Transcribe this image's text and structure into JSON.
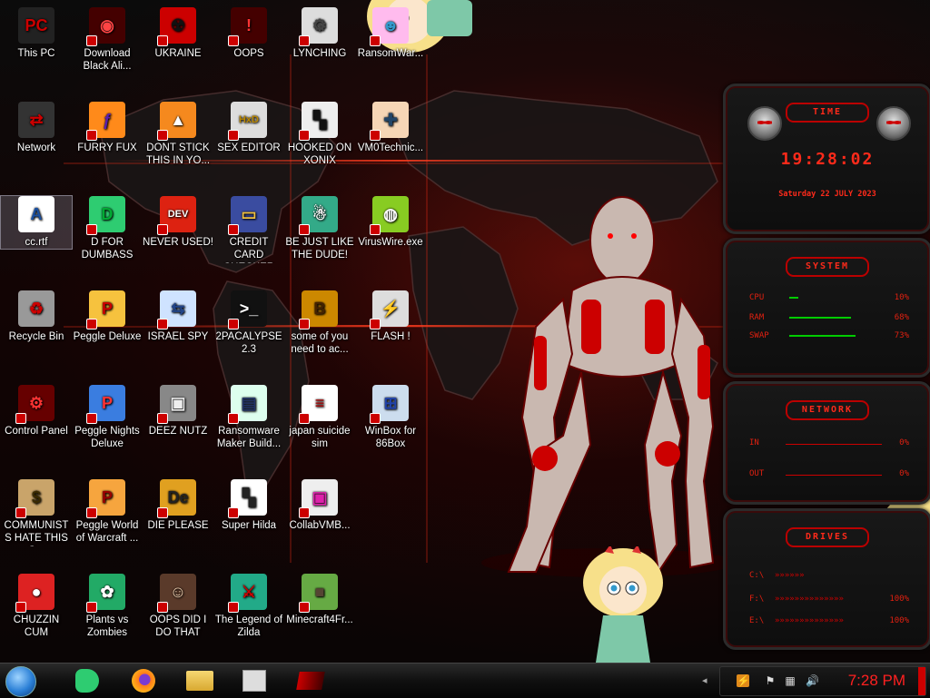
{
  "desktop": {
    "icons": [
      {
        "label": "This PC",
        "icon": "this-pc-icon"
      },
      {
        "label": "Network",
        "icon": "network-icon"
      },
      {
        "label": "cc.rtf",
        "icon": "rtf-document-icon"
      },
      {
        "label": "Recycle Bin",
        "icon": "recycle-bin-icon"
      },
      {
        "label": "Control Panel",
        "icon": "control-panel-icon"
      },
      {
        "label": "COMMUNISTS HATE THIS G...",
        "icon": "money-bag-icon"
      },
      {
        "label": "CHUZZIN CUM",
        "icon": "chuzzle-icon"
      },
      {
        "label": "Download Black Ali...",
        "icon": "alien-download-icon"
      },
      {
        "label": "FURRY FUX",
        "icon": "firefox-icon"
      },
      {
        "label": "D FOR DUMBASS",
        "icon": "d-app-icon"
      },
      {
        "label": "Peggle Deluxe",
        "icon": "peggle-icon"
      },
      {
        "label": "Peggle Nights Deluxe",
        "icon": "peggle-nights-icon"
      },
      {
        "label": "Peggle World of Warcraft ...",
        "icon": "peggle-wow-icon"
      },
      {
        "label": "Plants vs Zombies",
        "icon": "plants-vs-zombies-icon"
      },
      {
        "label": "UKRAINE",
        "icon": "radiation-icon"
      },
      {
        "label": "DONT STICK THIS IN YO...",
        "icon": "vlc-cone-icon"
      },
      {
        "label": "NEVER USED!",
        "icon": "dev-cpp-icon"
      },
      {
        "label": "ISRAEL SPY",
        "icon": "network-share-icon"
      },
      {
        "label": "DEEZ NUTZ",
        "icon": "windows-stack-icon"
      },
      {
        "label": "DIE PLEASE",
        "icon": "de-app-icon"
      },
      {
        "label": "OOPS DID I DO THAT",
        "icon": "portrait-icon"
      },
      {
        "label": "OOPS",
        "icon": "oops-app-icon"
      },
      {
        "label": "SEX EDITOR",
        "icon": "hxd-icon"
      },
      {
        "label": "CREDIT CARD CHECKER",
        "icon": "credit-card-icon"
      },
      {
        "label": "2PACALYPSE 2.3",
        "icon": "console-icon"
      },
      {
        "label": "Ransomware Maker Build...",
        "icon": "window-app-icon"
      },
      {
        "label": "Super Hilda",
        "icon": "pixel-game-icon"
      },
      {
        "label": "The Legend of Zilda",
        "icon": "link-sprite-icon"
      },
      {
        "label": "LYNCHING",
        "icon": "gear-flag-icon"
      },
      {
        "label": "HOOKED ON XONIX",
        "icon": "xonix-icon"
      },
      {
        "label": "BE JUST LIKE THE DUDE!",
        "icon": "santa-icon"
      },
      {
        "label": "some of you need to ac...",
        "icon": "beaver-icon"
      },
      {
        "label": "japan suicide sim",
        "icon": "document-sim-icon"
      },
      {
        "label": "CollabVMB...",
        "icon": "collabvm-icon"
      },
      {
        "label": "Minecraft4Fr...",
        "icon": "minecraft-icon"
      },
      {
        "label": "RansomWar...",
        "icon": "cartoon-icon"
      },
      {
        "label": "VM0Technic...",
        "icon": "doctor-icon"
      },
      {
        "label": "VirusWire.exe",
        "icon": "lime-icon"
      },
      {
        "label": "FLASH !",
        "icon": "flash-installer-icon"
      },
      {
        "label": "WinBox for 86Box",
        "icon": "winbox-icon"
      }
    ]
  },
  "widget": {
    "time_title": "TIME",
    "time": "19:28:02",
    "date": "Saturday 22 JULY 2023",
    "system_title": "SYSTEM",
    "cpu_label": "CPU",
    "cpu_value": "10%",
    "cpu_fill": 0.1,
    "ram_label": "RAM",
    "ram_value": "68%",
    "ram_fill": 0.68,
    "swap_label": "SWAP",
    "swap_value": "73%",
    "swap_fill": 0.73,
    "network_title": "NETWORK",
    "in_label": "IN",
    "in_value": "0%",
    "out_label": "OUT",
    "out_value": "0%",
    "drives_title": "DRIVES",
    "drive_c": "C:\\",
    "drive_f": "F:\\",
    "drive_f_value": "100%",
    "drive_e": "E:\\",
    "drive_e_value": "100%"
  },
  "taskbar": {
    "start": "start-orb-icon",
    "pinned": [
      "d-app-icon",
      "firefox-icon",
      "file-explorer-icon",
      "computer-icon",
      "control-panel-icon"
    ],
    "clock": "7:28 PM",
    "tray": [
      "security-icon",
      "flag-icon",
      "network-icon",
      "volume-icon"
    ]
  },
  "colors": {
    "accent": "#ff2a1a",
    "taskbar": "#101010",
    "clock": "#ff2020"
  }
}
